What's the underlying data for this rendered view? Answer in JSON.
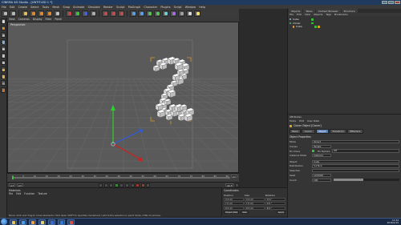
{
  "window": {
    "title": "CINEMA 4D Studio - [UNTITLED 1 *]"
  },
  "menubar": [
    "File",
    "Edit",
    "Create",
    "Select",
    "Tools",
    "Mesh",
    "Snap",
    "Animate",
    "Simulate",
    "Render",
    "Sculpt",
    "MoGraph",
    "Character",
    "Plugins",
    "Script",
    "Window",
    "Help"
  ],
  "toolbar": {
    "icons": [
      "undo-icon",
      "redo-icon",
      "live-selection-icon",
      "move-icon",
      "scale-icon",
      "rotate-icon",
      "recent-tool-icon",
      "x-axis-icon",
      "y-axis-icon",
      "z-axis-icon",
      "coordinate-system-icon",
      "render-view-icon",
      "render-to-picture-viewer-icon",
      "render-settings-icon",
      "cube-icon",
      "pen-icon",
      "subdivision-icon",
      "array-icon",
      "cloner-icon",
      "deformer-icon",
      "floor-icon",
      "camera-icon",
      "light-icon"
    ]
  },
  "viewport": {
    "menu": [
      "View",
      "Cameras",
      "Display",
      "Filter",
      "Panel"
    ],
    "label": "Perspective"
  },
  "timeline": {
    "ticks": [
      "0",
      "5",
      "10",
      "15",
      "20",
      "25",
      "30",
      "35",
      "40",
      "45",
      "50",
      "55",
      "60",
      "65",
      "70",
      "75",
      "80",
      "85",
      "90"
    ],
    "frame_indicator": "0 F",
    "start_frame": "0 F",
    "end_frame": "90 F",
    "current_frame": "0 F"
  },
  "materials": {
    "title": "Materials",
    "menu": [
      "File",
      "Edit",
      "Function",
      "Texture"
    ]
  },
  "coordinates": {
    "title": "Coordinates",
    "headers": [
      "Position",
      "Size",
      "Rotation"
    ],
    "rows": [
      {
        "pos": "X 0 cm",
        "size": "X 0 cm",
        "rot": "H 0 °"
      },
      {
        "pos": "Y 0 cm",
        "size": "Y 0 cm",
        "rot": "P 0 °"
      },
      {
        "pos": "Z 0 cm",
        "size": "Z 0 cm",
        "rot": "B 0 °"
      }
    ],
    "mode": "Object (Rel)",
    "size_mode": "Size",
    "apply_label": "Apply"
  },
  "object_manager": {
    "tabs": [
      "Objects",
      "Takes",
      "Content Browser",
      "Structure"
    ],
    "menu": [
      "File",
      "Edit",
      "View",
      "Objects",
      "Tags",
      "Bookmarks"
    ],
    "objects": [
      {
        "name": "Cube",
        "color": "#8fb7e8"
      },
      {
        "name": "Cloner",
        "color": "#3fc45a"
      },
      {
        "name": "Cube",
        "color": "#e2a13a"
      }
    ]
  },
  "attributes": {
    "tab": "Attributes",
    "menu": [
      "Mode",
      "Edit",
      "User Data"
    ],
    "object_label": "Cloner Object [Cloner]",
    "tabs": [
      "Basic",
      "Coord.",
      "Object",
      "Transform",
      "Effectors"
    ],
    "active_tab": "Object",
    "section": "Object Properties",
    "props": {
      "mode_label": "Mode",
      "mode_value": "Object",
      "clones_label": "Clones",
      "clones_value": "Iterate",
      "fix_clone_label": "Fix Clone",
      "fix_texture_label": "Fix Texture",
      "fix_texture_value": "Off",
      "instance_mode_label": "Instance Mode",
      "instance_mode_value": "Instance",
      "object_label": "Object",
      "object_value": "Cube",
      "distribution_label": "Distribution",
      "distribution_value": "Surface",
      "selection_label": "Selection",
      "seed_label": "Seed",
      "seed_value": "1234567",
      "count_label": "Count",
      "count_value": "100"
    }
  },
  "status": {
    "text": "Move: Click and drag to move elements. Hold down SHIFT to quantize movement / add to the selection in point mode, CTRL to remove."
  },
  "taskbar": {
    "apps": [
      "explorer",
      "ie",
      "media-player",
      "folder",
      "cinema4d",
      "photoshop",
      "chrome"
    ],
    "time": "11:44",
    "date": "2016/1/15"
  },
  "colors": {
    "accent": "#5d7fb4",
    "viewport_bg": "#5a5a5a",
    "grid": "#6b6b6b",
    "clone_box": "#f0f0f0",
    "y_axis": "#2bd02b",
    "x_axis": "#d02020",
    "z_axis": "#2f5be0",
    "bbox": "#d89a2a"
  }
}
